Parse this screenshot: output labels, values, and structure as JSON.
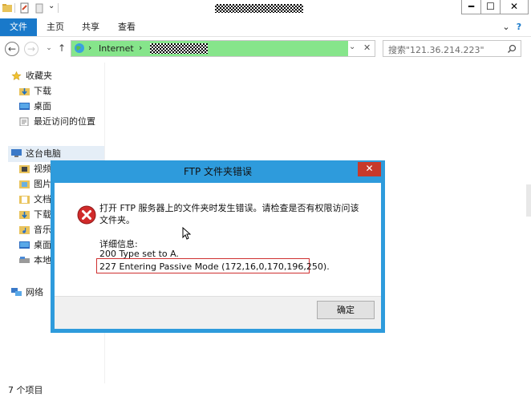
{
  "window": {
    "title_redacted": true
  },
  "titlebar_buttons": {
    "minimize": "━",
    "maximize": "☐",
    "close": "✕"
  },
  "ribbon": {
    "tabs": [
      "文件",
      "主页",
      "共享",
      "查看"
    ],
    "chevron": "⌄",
    "help": "?"
  },
  "address": {
    "back": "←",
    "forward": "→",
    "history": "⌄",
    "up": "↑",
    "segment": "Internet",
    "sep": "›",
    "dropdown": "⌄",
    "clear": "✕"
  },
  "search": {
    "placeholder": "搜索\"121.36.214.223\""
  },
  "nav": {
    "favorites": "收藏夹",
    "downloads": "下载",
    "desktop": "桌面",
    "recent": "最近访问的位置",
    "thispc": "这台电脑",
    "pc_items": [
      "视频",
      "图片",
      "文档",
      "下载",
      "音乐",
      "桌面",
      "本地"
    ],
    "network": "网络"
  },
  "status": {
    "items": "7 个项目"
  },
  "dialog": {
    "title": "FTP 文件夹错误",
    "close": "✕",
    "message": "打开 FTP 服务器上的文件夹时发生错误。请检查是否有权限访问该文件夹。",
    "details_label": "详细信息:",
    "detail_line1": "200 Type set to A.",
    "detail_line2": "227 Entering Passive Mode (172,16,0,170,196,250).",
    "ok": "确定"
  },
  "colors": {
    "accent": "#1979ca",
    "dialog_frame": "#2e9bdc",
    "close_red": "#c7392b",
    "address_green": "#86e58b",
    "highlight_red": "#cf3030"
  }
}
